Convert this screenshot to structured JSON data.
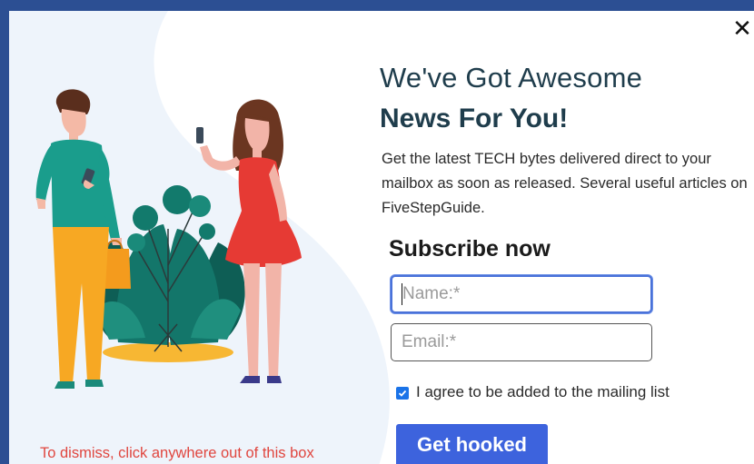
{
  "modal": {
    "close_symbol": "✕",
    "heading_line1": "We've Got Awesome",
    "heading_line2": "News For You!",
    "description": "Get the latest TECH bytes delivered direct to your mailbox as soon as released. Several useful articles on FiveStepGuide.",
    "subscribe_title": "Subscribe now",
    "name_placeholder": "Name:*",
    "email_placeholder": "Email:*",
    "agree_label": "I agree to be added to the mailing list",
    "agree_checked": true,
    "submit_label": "Get hooked",
    "dismiss_text": "To dismiss, click anywhere out of this box",
    "illustration": "couple-with-phones-and-plant-illustration"
  },
  "colors": {
    "page_background": "#2c4f93",
    "modal_background": "#ffffff",
    "blob": "#eef4fb",
    "heading": "#1f3d4c",
    "button": "#3d63dd",
    "checkbox": "#1a73e8",
    "dismiss_text": "#e0463f",
    "field_focus_border": "#4a72d9"
  }
}
